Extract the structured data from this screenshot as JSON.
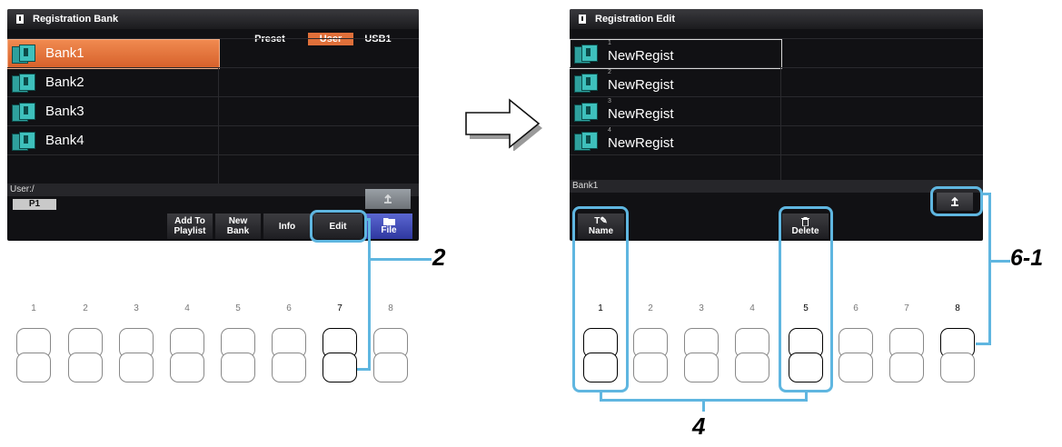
{
  "left_screen": {
    "title": "Registration Bank",
    "tabs": [
      "Preset",
      "User",
      "USB1"
    ],
    "active_tab": "User",
    "banks": [
      "Bank1",
      "Bank2",
      "Bank3",
      "Bank4"
    ],
    "path": "User:/",
    "page": "P1",
    "buttons": {
      "add_to_playlist": "Add To\nPlaylist",
      "new_bank": "New\nBank",
      "info": "Info",
      "edit": "Edit",
      "file": "File"
    }
  },
  "right_screen": {
    "title": "Registration Edit",
    "items": [
      {
        "num": "1",
        "name": "NewRegist"
      },
      {
        "num": "2",
        "name": "NewRegist"
      },
      {
        "num": "3",
        "name": "NewRegist"
      },
      {
        "num": "4",
        "name": "NewRegist"
      }
    ],
    "bank_label": "Bank1",
    "buttons": {
      "name": "Name",
      "delete": "Delete"
    }
  },
  "left_panel_numbers": [
    "1",
    "2",
    "3",
    "4",
    "5",
    "6",
    "7",
    "8"
  ],
  "right_panel_numbers": [
    "1",
    "2",
    "3",
    "4",
    "5",
    "6",
    "7",
    "8"
  ],
  "callouts": {
    "edit_step": "2",
    "name_delete_step": "4",
    "up_step": "6-1"
  },
  "colors": {
    "accent": "#e0703a",
    "callout": "#5fb6e0",
    "file_button": "#3f48b8"
  }
}
